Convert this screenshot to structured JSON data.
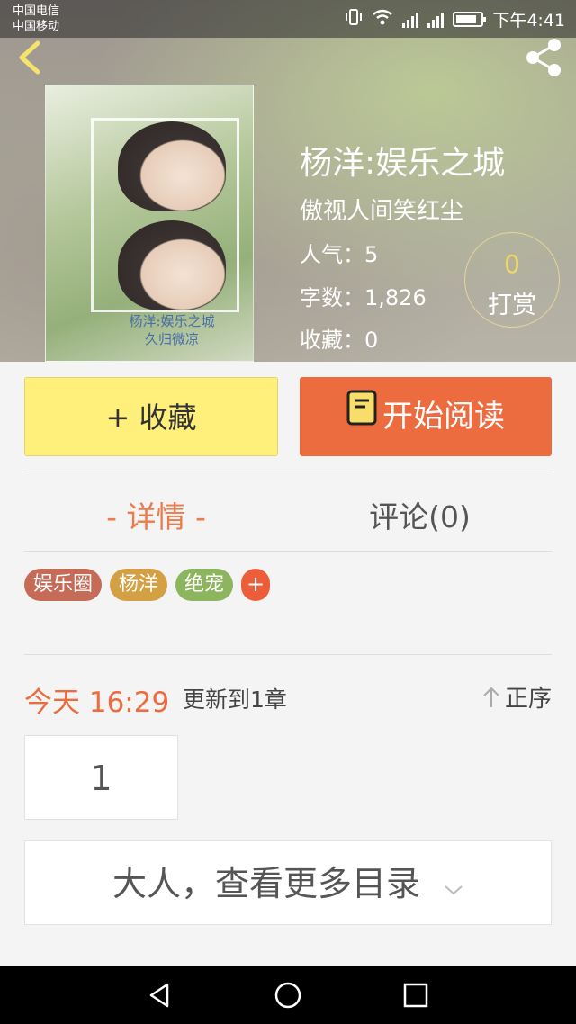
{
  "status_bar": {
    "carrier_1": "中国电信",
    "carrier_2": "中国移动",
    "time": "下午4:41"
  },
  "book": {
    "title": "杨洋:娱乐之城",
    "author": "傲视人间笑红尘",
    "cover_text_line1": "杨洋:娱乐之城",
    "cover_text_line2": "久归微凉",
    "popularity_label": "人气：",
    "popularity_value": "5",
    "words_label": "字数：",
    "words_value": "1,826",
    "favorites_label": "收藏：",
    "favorites_value": "0"
  },
  "tip": {
    "count": "0",
    "label": "打赏"
  },
  "actions": {
    "favorite_label": "+ 收藏",
    "read_label": "开始阅读"
  },
  "tabs": {
    "detail": "- 详情 -",
    "comments": "评论(0)"
  },
  "tags": [
    {
      "label": "娱乐圈",
      "color": "#c56b57"
    },
    {
      "label": "杨洋",
      "color": "#d4a044"
    },
    {
      "label": "绝宠",
      "color": "#8cb55e"
    }
  ],
  "tag_add_label": "+",
  "update": {
    "time": "今天 16:29",
    "text": "更新到1章",
    "order_label": "正序"
  },
  "chapters": [
    "1"
  ],
  "more_catalog_label": "大人，查看更多目录",
  "colors": {
    "accent_orange": "#ec6c3f",
    "favorite_yellow": "#fff07c"
  }
}
